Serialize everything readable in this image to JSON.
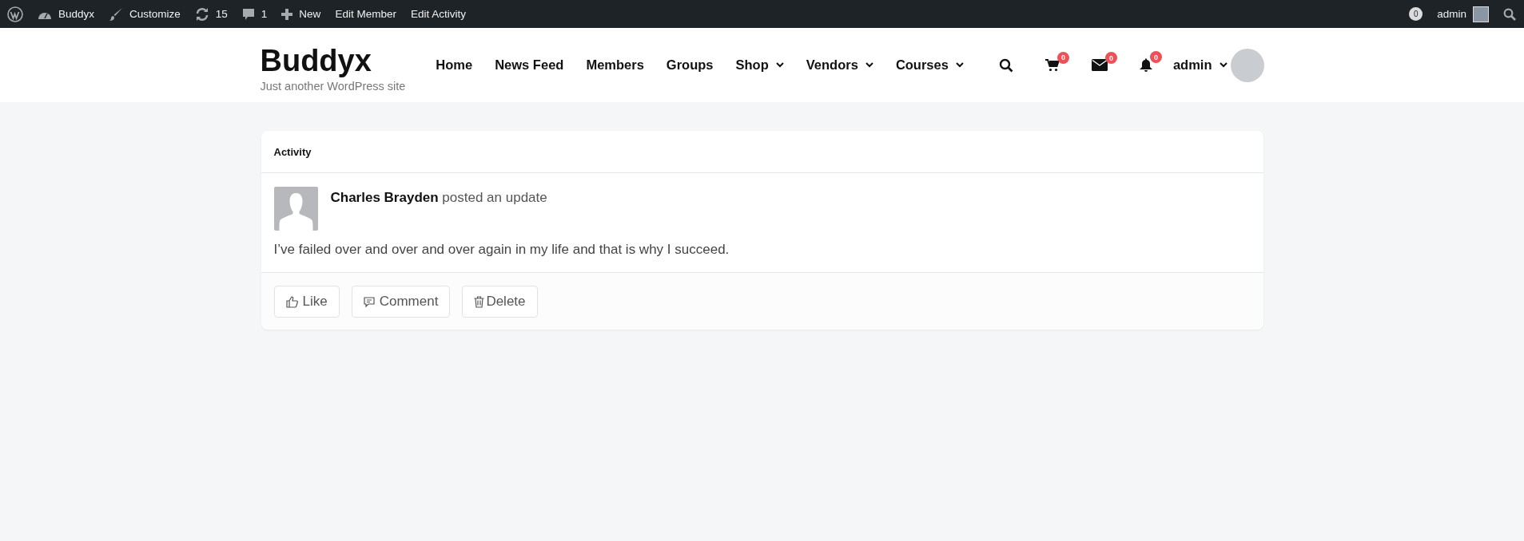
{
  "admin_bar": {
    "left": [
      {
        "kind": "wordpress"
      },
      {
        "kind": "dashboard",
        "label": "Buddyx"
      },
      {
        "kind": "brush",
        "label": "Customize"
      },
      {
        "kind": "updates",
        "label": "15"
      },
      {
        "kind": "comments",
        "label": "1"
      },
      {
        "kind": "plus",
        "label": "New"
      },
      {
        "kind": "text",
        "label": "Edit Member"
      },
      {
        "kind": "text",
        "label": "Edit Activity"
      }
    ],
    "notification_count": "0",
    "user": "admin"
  },
  "header": {
    "site_title": "Buddyx",
    "tagline": "Just another WordPress site",
    "nav": [
      {
        "label": "Home",
        "has_submenu": false
      },
      {
        "label": "News Feed",
        "has_submenu": false
      },
      {
        "label": "Members",
        "has_submenu": false
      },
      {
        "label": "Groups",
        "has_submenu": false
      },
      {
        "label": "Shop",
        "has_submenu": true
      },
      {
        "label": "Vendors",
        "has_submenu": true
      },
      {
        "label": "Courses",
        "has_submenu": true
      }
    ],
    "icons": [
      {
        "kind": "search"
      },
      {
        "kind": "cart",
        "count": "0"
      },
      {
        "kind": "mail",
        "count": "0"
      },
      {
        "kind": "bell",
        "count": "0"
      }
    ],
    "user": "admin"
  },
  "card": {
    "title": "Activity",
    "author": "Charles Brayden",
    "action": "posted an update",
    "content": "I’ve failed over and over and over again in my life and that is why I succeed.",
    "actions": [
      {
        "kind": "like",
        "label": "Like"
      },
      {
        "kind": "comment",
        "label": "Comment"
      },
      {
        "kind": "delete",
        "label": "Delete"
      }
    ]
  }
}
